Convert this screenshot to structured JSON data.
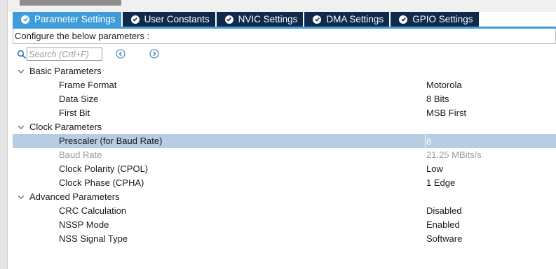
{
  "tabs": [
    {
      "label": "Parameter Settings",
      "active": true
    },
    {
      "label": "User Constants",
      "active": false
    },
    {
      "label": "NVIC Settings",
      "active": false
    },
    {
      "label": "DMA Settings",
      "active": false
    },
    {
      "label": "GPIO Settings",
      "active": false
    }
  ],
  "configure_label": "Configure the below parameters :",
  "search": {
    "placeholder": "Search (Crtl+F)",
    "value": ""
  },
  "groups": [
    {
      "label": "Basic Parameters",
      "expanded": true,
      "params": [
        {
          "name": "Frame Format",
          "value": "Motorola"
        },
        {
          "name": "Data Size",
          "value": "8 Bits"
        },
        {
          "name": "First Bit",
          "value": "MSB First"
        }
      ]
    },
    {
      "label": "Clock Parameters",
      "expanded": true,
      "params": [
        {
          "name": "Prescaler (for Baud Rate)",
          "value": "8",
          "selected": true
        },
        {
          "name": "Baud Rate",
          "value": "21.25 MBits/s",
          "disabled": true
        },
        {
          "name": "Clock Polarity (CPOL)",
          "value": "Low"
        },
        {
          "name": "Clock Phase (CPHA)",
          "value": "1 Edge"
        }
      ]
    },
    {
      "label": "Advanced Parameters",
      "expanded": true,
      "params": [
        {
          "name": "CRC Calculation",
          "value": "Disabled"
        },
        {
          "name": "NSSP Mode",
          "value": "Enabled"
        },
        {
          "name": "NSS Signal Type",
          "value": "Software"
        }
      ]
    }
  ],
  "colors": {
    "tab_active": "#3e9dd8",
    "tab_inactive": "#0f2a4a",
    "selected_row": "#b6cde3",
    "disabled_text": "#9b9b9b"
  }
}
